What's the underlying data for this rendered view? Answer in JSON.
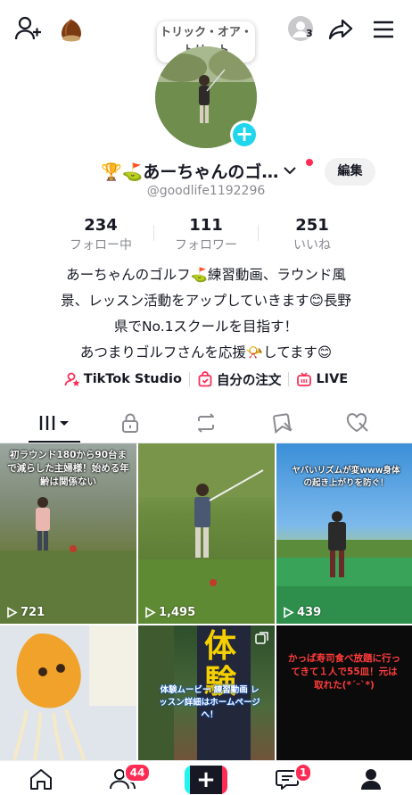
{
  "topbar": {
    "tooltip_text": "トリック・オア・トリート",
    "viewers_count": "3",
    "icons": [
      "add-friend-icon",
      "chestnut-icon",
      "viewer-avatar-icon",
      "share-icon",
      "menu-icon"
    ]
  },
  "profile": {
    "name": "🏆⛳あーちゃんのゴ…",
    "edit_label": "編集",
    "username": "@goodlife1192296",
    "stats": [
      {
        "value": "234",
        "label": "フォロー中"
      },
      {
        "value": "111",
        "label": "フォロワー"
      },
      {
        "value": "251",
        "label": "いいね"
      }
    ],
    "bio_lines": [
      "あーちゃんのゴルフ⛳練習動画、ラウンド風",
      "景、レッスン活動をアップしていきます😊長野",
      "県でNo.1スクールを目指す！",
      "あつまりゴルフさんを応援📯してます😊"
    ],
    "links": [
      {
        "label": "TikTok Studio",
        "icon": "studio-icon"
      },
      {
        "label": "自分の注文",
        "icon": "shopping-bag-icon"
      },
      {
        "label": "LIVE",
        "icon": "live-tv-icon"
      }
    ]
  },
  "tabs": [
    {
      "name": "videos-grid",
      "icon": "grid-icon",
      "active": true
    },
    {
      "name": "private",
      "icon": "lock-icon"
    },
    {
      "name": "reposts",
      "icon": "repost-icon"
    },
    {
      "name": "favorites",
      "icon": "bookmark-hidden-icon"
    },
    {
      "name": "liked",
      "icon": "heart-hidden-icon"
    }
  ],
  "videos": [
    {
      "views": "721",
      "caption": "初ラウンド180から90台まで減らした主婦様！始める年齢は関係ない"
    },
    {
      "views": "1,495",
      "caption": ""
    },
    {
      "views": "439",
      "caption": "ヤバいリズムが変www身体の起き上がりを防ぐ！"
    },
    {
      "views": "",
      "caption": ""
    },
    {
      "views": "",
      "caption": "体験ムービー 練習動画 レッスン詳細はホームページへ！",
      "sign": "体験"
    },
    {
      "views": "",
      "caption": "かっぱ寿司食べ放題に行ってきて１人で55皿！元は取れた(*´ᵕ`*)"
    }
  ],
  "bottom_nav": {
    "items": [
      "home",
      "friends",
      "create",
      "inbox",
      "profile"
    ],
    "friends_badge": "44",
    "inbox_badge": "1"
  },
  "colors": {
    "accent": "#fe2c55",
    "cyan": "#20d5ec"
  }
}
